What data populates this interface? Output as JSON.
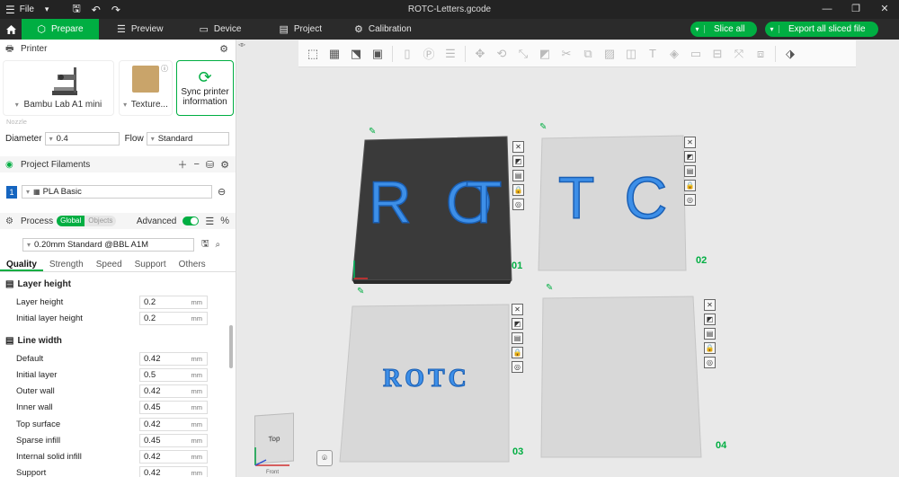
{
  "titlebar": {
    "menu_label": "File",
    "title": "ROTC-Letters.gcode",
    "icons": [
      "hamburger-icon",
      "chevron-down-icon",
      "save-icon",
      "undo-icon",
      "redo-icon"
    ]
  },
  "nav": {
    "tabs": [
      {
        "label": "Prepare",
        "icon": "cube-icon",
        "active": true
      },
      {
        "label": "Preview",
        "icon": "layers-icon",
        "active": false
      },
      {
        "label": "Device",
        "icon": "monitor-icon",
        "active": false
      },
      {
        "label": "Project",
        "icon": "project-icon",
        "active": false
      },
      {
        "label": "Calibration",
        "icon": "calibration-icon",
        "active": false
      }
    ],
    "slice_all": "Slice all",
    "export_all": "Export all sliced file",
    "accent": "#00ae42"
  },
  "printer": {
    "section_title": "Printer",
    "printer_name": "Bambu Lab A1 mini",
    "plate_name": "Texture...",
    "sync_label": "Sync printer information",
    "nozzle_label": "Nozzle",
    "diameter_label": "Diameter",
    "diameter_value": "0.4",
    "flow_label": "Flow",
    "flow_value": "Standard"
  },
  "filaments": {
    "section_title": "Project Filaments",
    "items": [
      {
        "index": "1",
        "name": "PLA Basic",
        "color": "#1565c0"
      }
    ]
  },
  "process": {
    "section_title": "Process",
    "toggle_global": "Global",
    "toggle_objects": "Objects",
    "advanced_label": "Advanced",
    "preset": "0.20mm Standard @BBL A1M",
    "tabs": [
      "Quality",
      "Strength",
      "Speed",
      "Support",
      "Others"
    ],
    "active_tab": "Quality",
    "groups": [
      {
        "title": "Layer height",
        "params": [
          {
            "label": "Layer height",
            "value": "0.2",
            "unit": "mm"
          },
          {
            "label": "Initial layer height",
            "value": "0.2",
            "unit": "mm"
          }
        ]
      },
      {
        "title": "Line width",
        "params": [
          {
            "label": "Default",
            "value": "0.42",
            "unit": "mm"
          },
          {
            "label": "Initial layer",
            "value": "0.5",
            "unit": "mm"
          },
          {
            "label": "Outer wall",
            "value": "0.42",
            "unit": "mm"
          },
          {
            "label": "Inner wall",
            "value": "0.45",
            "unit": "mm"
          },
          {
            "label": "Top surface",
            "value": "0.42",
            "unit": "mm"
          },
          {
            "label": "Sparse infill",
            "value": "0.45",
            "unit": "mm"
          },
          {
            "label": "Internal solid infill",
            "value": "0.42",
            "unit": "mm"
          },
          {
            "label": "Support",
            "value": "0.42",
            "unit": "mm"
          }
        ]
      }
    ]
  },
  "canvas": {
    "plates": [
      {
        "number": "01",
        "text": "R O",
        "text2": "T",
        "active": true
      },
      {
        "number": "02",
        "text": "T C",
        "active": false
      },
      {
        "number": "03",
        "text": "ROTC",
        "active": false
      },
      {
        "number": "04",
        "text": "",
        "active": false
      }
    ],
    "view_label": "Top",
    "view_label_front": "Front",
    "letter_color": "#3d8fe8"
  }
}
